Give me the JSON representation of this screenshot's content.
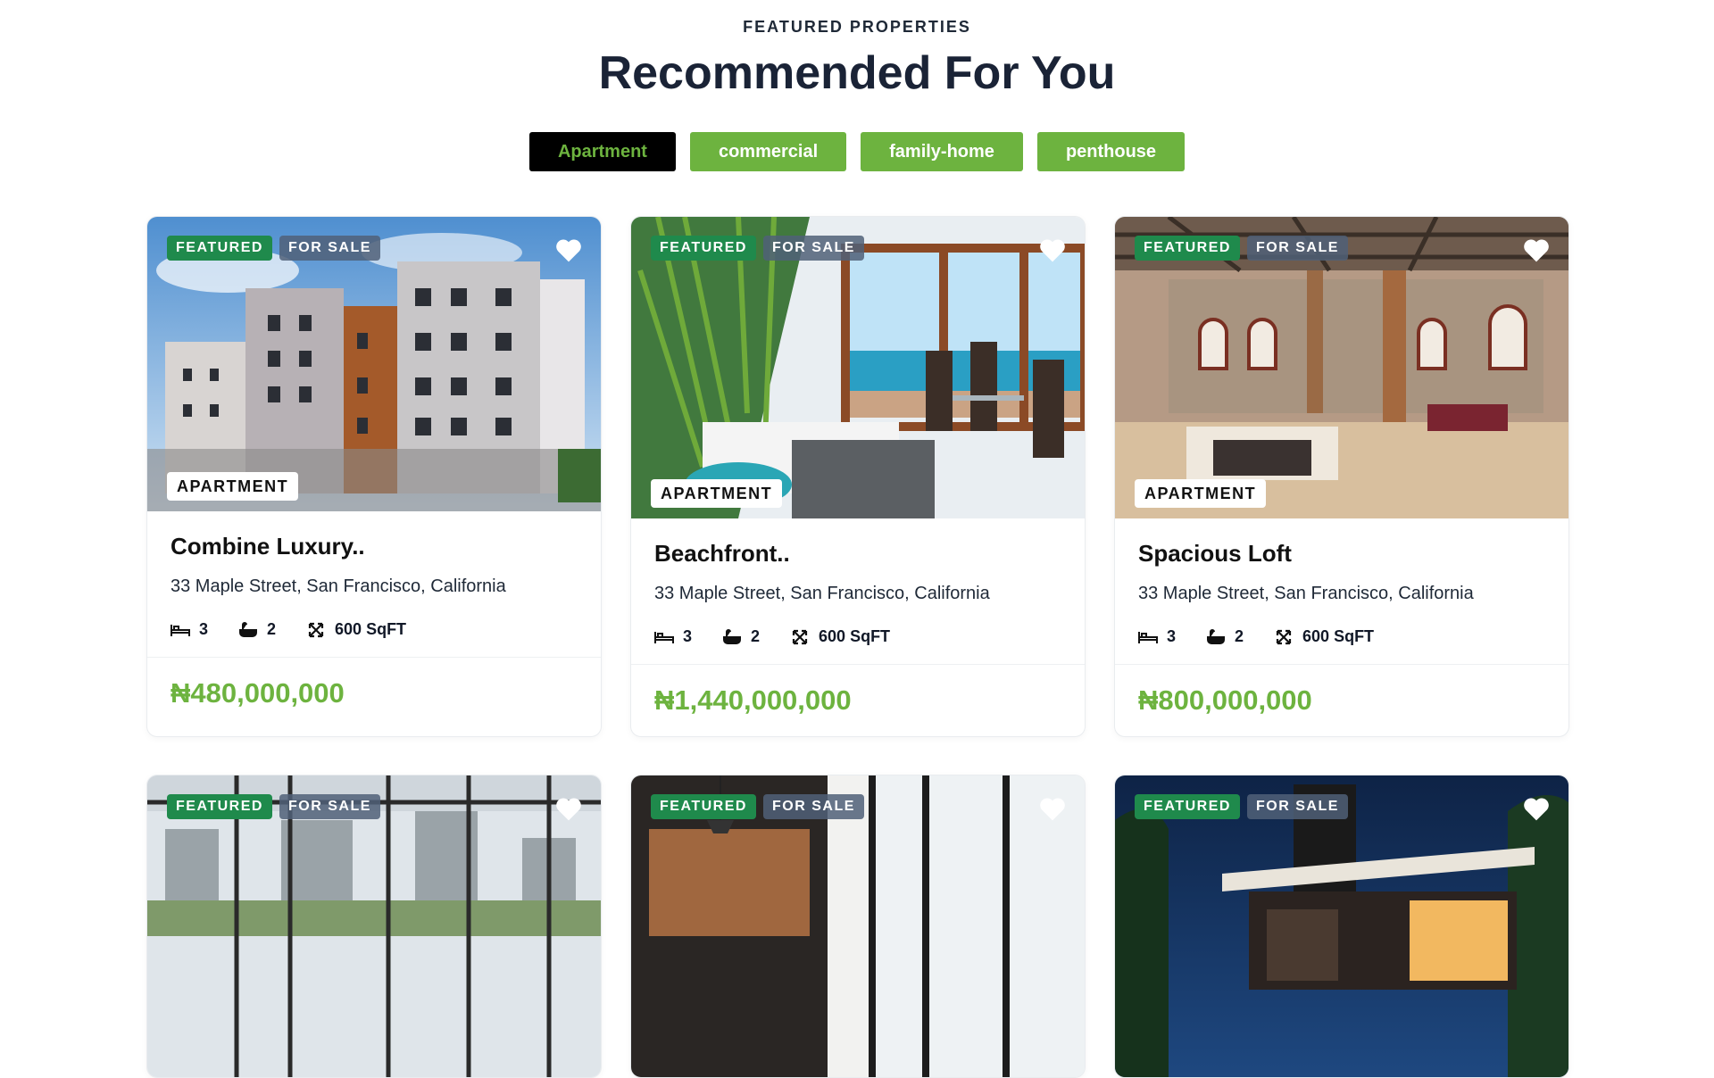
{
  "header": {
    "eyebrow": "FEATURED PROPERTIES",
    "title": "Recommended For You"
  },
  "filters": [
    {
      "label": "Apartment",
      "active": true
    },
    {
      "label": "commercial",
      "active": false
    },
    {
      "label": "family-home",
      "active": false
    },
    {
      "label": "penthouse",
      "active": false
    }
  ],
  "colors": {
    "accent_green": "#6db33f",
    "featured_badge": "#1f8a4c",
    "heading": "#1a2336"
  },
  "cards": [
    {
      "featured_label": "FEATURED",
      "status_label": "FOR SALE",
      "type_label": "APARTMENT",
      "title": "Combine Luxury..",
      "address": "33 Maple Street, San Francisco, California",
      "beds": "3",
      "baths": "2",
      "area": "600 SqFT",
      "price": "₦480,000,000",
      "image": "apartment-building-exterior"
    },
    {
      "featured_label": "FEATURED",
      "status_label": "FOR SALE",
      "type_label": "APARTMENT",
      "title": "Beachfront..",
      "address": "33 Maple Street, San Francisco, California",
      "beds": "3",
      "baths": "2",
      "area": "600 SqFT",
      "price": "₦1,440,000,000",
      "image": "beachfront-bedroom-interior"
    },
    {
      "featured_label": "FEATURED",
      "status_label": "FOR SALE",
      "type_label": "APARTMENT",
      "title": "Spacious Loft",
      "address": "33 Maple Street, San Francisco, California",
      "beds": "3",
      "baths": "2",
      "area": "600 SqFT",
      "price": "₦800,000,000",
      "image": "brick-loft-interior"
    },
    {
      "featured_label": "FEATURED",
      "status_label": "FOR SALE",
      "image": "city-view-living-room"
    },
    {
      "featured_label": "FEATURED",
      "status_label": "FOR SALE",
      "image": "modern-kitchen-interior"
    },
    {
      "featured_label": "FEATURED",
      "status_label": "FOR SALE",
      "image": "modern-house-night-exterior"
    }
  ],
  "icons": {
    "favorite": "heart-icon",
    "beds": "bed-icon",
    "baths": "bath-icon",
    "area": "area-icon"
  }
}
